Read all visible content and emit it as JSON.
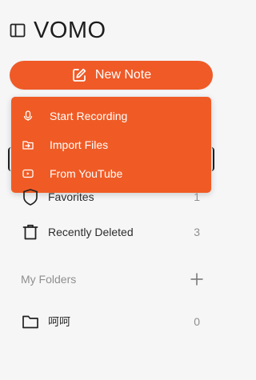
{
  "app": {
    "title": "VOMO"
  },
  "new_note": {
    "label": "New Note"
  },
  "menu": {
    "items": [
      {
        "label": "Start Recording",
        "icon": "microphone-icon"
      },
      {
        "label": "Import Files",
        "icon": "import-icon"
      },
      {
        "label": "From YouTube",
        "icon": "youtube-icon"
      }
    ]
  },
  "nav": {
    "favorites": {
      "label": "Favorites",
      "count": "1"
    },
    "recently_deleted": {
      "label": "Recently Deleted",
      "count": "3"
    }
  },
  "folders": {
    "heading": "My Folders",
    "items": [
      {
        "label": "呵呵",
        "count": "0"
      }
    ]
  },
  "colors": {
    "accent": "#ef5a27",
    "background": "#f6f6f7"
  }
}
